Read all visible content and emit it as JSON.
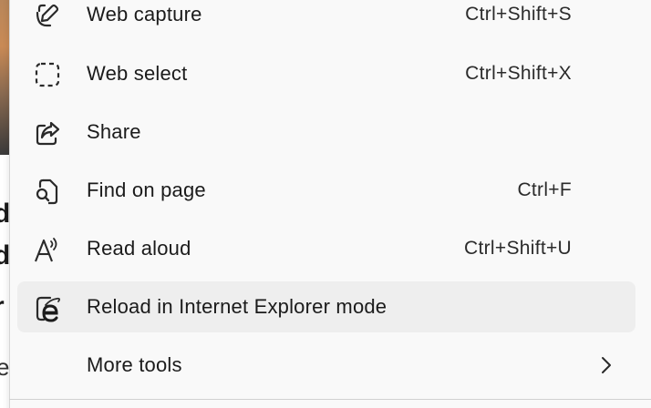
{
  "menu": {
    "items": [
      {
        "label": "Web capture",
        "shortcut": "Ctrl+Shift+S",
        "icon": "web-capture-icon"
      },
      {
        "label": "Web select",
        "shortcut": "Ctrl+Shift+X",
        "icon": "web-select-icon"
      },
      {
        "label": "Share",
        "shortcut": "",
        "icon": "share-icon"
      },
      {
        "label": "Find on page",
        "shortcut": "Ctrl+F",
        "icon": "find-on-page-icon"
      },
      {
        "label": "Read aloud",
        "shortcut": "Ctrl+Shift+U",
        "icon": "read-aloud-icon"
      },
      {
        "label": "Reload in Internet Explorer mode",
        "shortcut": "",
        "icon": "internet-explorer-icon"
      },
      {
        "label": "More tools",
        "shortcut": "",
        "icon": "chevron-right-icon"
      }
    ]
  },
  "background": {
    "glyphs": [
      "d",
      "d",
      "r",
      "e"
    ]
  },
  "colors": {
    "menu_bg": "#f9f9f9",
    "hover_bg": "#eeeeee",
    "text": "#1b1b1b",
    "icon": "#2a2a2a"
  }
}
